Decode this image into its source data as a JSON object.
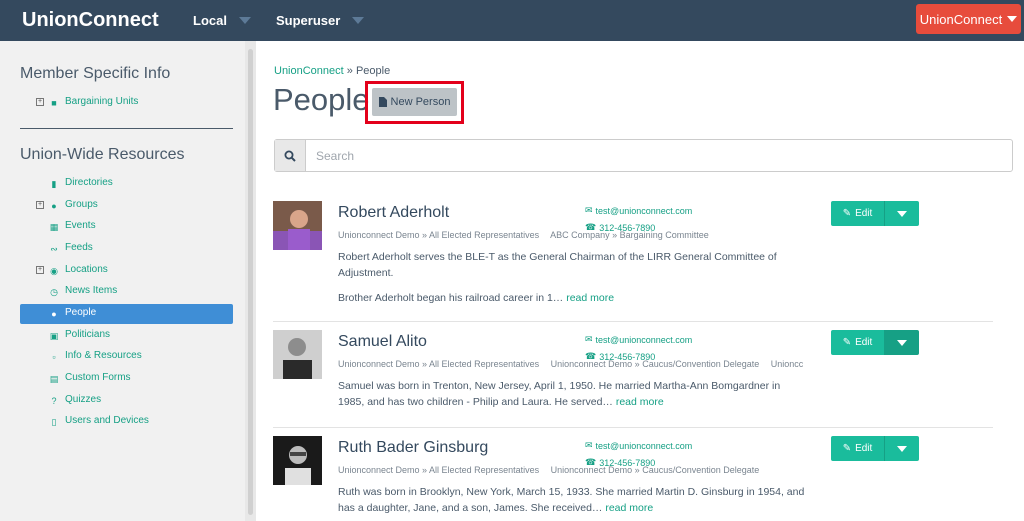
{
  "navbar": {
    "brand": "UnionConnect",
    "items": [
      {
        "label": "Local"
      },
      {
        "label": "Superuser"
      }
    ],
    "right_button": "UnionConnect"
  },
  "sidebar": {
    "section1_title": "Member Specific Info",
    "section1_items": [
      {
        "label": "Bargaining Units",
        "icon": "truck-icon",
        "expandable": true
      }
    ],
    "section2_title": "Union-Wide Resources",
    "section2_items": [
      {
        "label": "Directories",
        "icon": "book-icon",
        "expandable": false
      },
      {
        "label": "Groups",
        "icon": "users-icon",
        "expandable": true
      },
      {
        "label": "Events",
        "icon": "calendar-icon",
        "expandable": false
      },
      {
        "label": "Feeds",
        "icon": "rss-icon",
        "expandable": false
      },
      {
        "label": "Locations",
        "icon": "globe-icon",
        "expandable": true
      },
      {
        "label": "News Items",
        "icon": "clock-icon",
        "expandable": false
      },
      {
        "label": "People",
        "icon": "user-icon",
        "expandable": false,
        "active": true
      },
      {
        "label": "Politicians",
        "icon": "id-card-icon",
        "expandable": false
      },
      {
        "label": "Info & Resources",
        "icon": "folder-icon",
        "expandable": false
      },
      {
        "label": "Custom Forms",
        "icon": "list-icon",
        "expandable": false
      },
      {
        "label": "Quizzes",
        "icon": "question-icon",
        "expandable": false
      },
      {
        "label": "Users and Devices",
        "icon": "tablet-icon",
        "expandable": false
      }
    ]
  },
  "breadcrumb": {
    "link": "UnionConnect",
    "separator": "»",
    "current": "People"
  },
  "page": {
    "title": "People",
    "new_button": "New Person"
  },
  "search": {
    "placeholder": "Search"
  },
  "people": [
    {
      "name": "Robert Aderholt",
      "email": "test@unionconnect.com",
      "phone": "312-456-7890",
      "groups": [
        "Unionconnect Demo » All Elected Representatives",
        "ABC Company » Bargaining Committee"
      ],
      "desc1": "Robert Aderholt serves the BLE-T as the General Chairman of the LIRR General Committee of Adjustment.",
      "desc2": "Brother Aderholt began his railroad career in 1…",
      "read_more": "read more",
      "edit": "Edit"
    },
    {
      "name": "Samuel Alito",
      "email": "test@unionconnect.com",
      "phone": "312-456-7890",
      "groups": [
        "Unionconnect Demo » All Elected Representatives",
        "Unionconnect Demo » Caucus/Convention Delegate",
        "Unioncc"
      ],
      "desc1": "Samuel was born in Trenton, New Jersey, April 1, 1950. He married Martha-Ann Bomgardner in 1985, and has two children - Philip and Laura. He served…",
      "desc2": "",
      "read_more": "read more",
      "edit": "Edit"
    },
    {
      "name": "Ruth Bader Ginsburg",
      "email": "test@unionconnect.com",
      "phone": "312-456-7890",
      "groups": [
        "Unionconnect Demo » All Elected Representatives",
        "Unionconnect Demo » Caucus/Convention Delegate"
      ],
      "desc1": "Ruth was born in Brooklyn, New York, March 15, 1933. She married Martin D. Ginsburg in 1954, and has a daughter, Jane, and a son, James. She received…",
      "desc2": "",
      "read_more": "read more",
      "edit": "Edit"
    }
  ]
}
